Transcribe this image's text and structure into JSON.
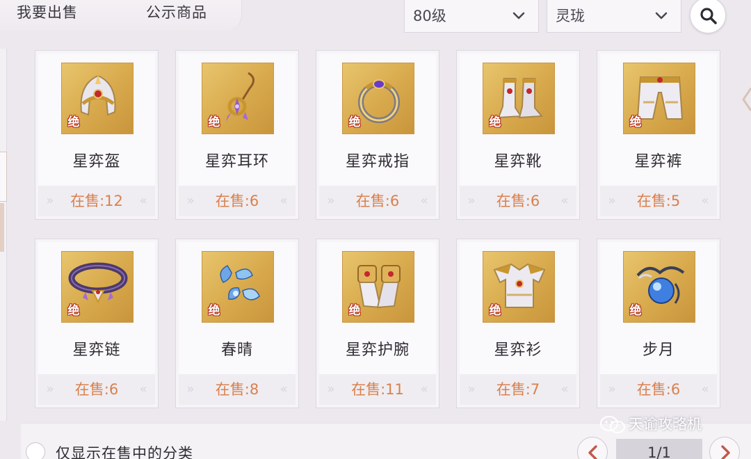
{
  "top_tabs": {
    "sell": "我要出售",
    "public": "公示商品"
  },
  "filters": {
    "level": "80级",
    "type": "灵珑"
  },
  "search_icon": "search-icon",
  "items": [
    {
      "name": "星弈盔",
      "count": "在售:12",
      "badge": "绝",
      "icon": "helmet-icon"
    },
    {
      "name": "星弈耳环",
      "count": "在售:6",
      "badge": "绝",
      "icon": "earring-icon"
    },
    {
      "name": "星弈戒指",
      "count": "在售:6",
      "badge": "绝",
      "icon": "ring-icon"
    },
    {
      "name": "星弈靴",
      "count": "在售:6",
      "badge": "绝",
      "icon": "boots-icon"
    },
    {
      "name": "星弈裤",
      "count": "在售:5",
      "badge": "绝",
      "icon": "pants-icon"
    },
    {
      "name": "星弈链",
      "count": "在售:6",
      "badge": "绝",
      "icon": "necklace-icon"
    },
    {
      "name": "春晴",
      "count": "在售:8",
      "badge": "绝",
      "icon": "butterfly-icon"
    },
    {
      "name": "星弈护腕",
      "count": "在售:11",
      "badge": "绝",
      "icon": "bracer-icon"
    },
    {
      "name": "星弈衫",
      "count": "在售:7",
      "badge": "绝",
      "icon": "armor-icon"
    },
    {
      "name": "步月",
      "count": "在售:6",
      "badge": "绝",
      "icon": "orb-icon"
    }
  ],
  "footer": {
    "filter_label": "仅显示在售中的分类",
    "page": "1/1"
  },
  "watermark": "天谕攻略机",
  "colors": {
    "count_text": "#d9804e",
    "icon_bg": "#d8a94c",
    "badge_outline": "#b5321f"
  }
}
